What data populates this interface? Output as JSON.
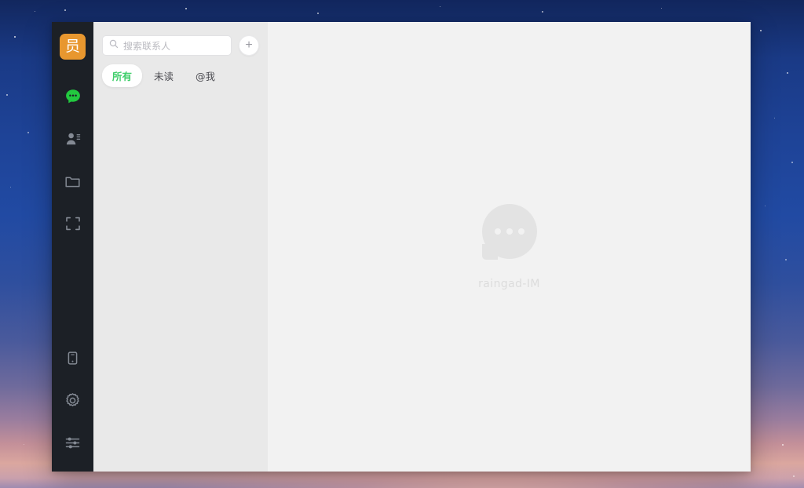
{
  "desktop": {
    "wallpaper_top_color": "#1e4397",
    "wallpaper_bottom_color": "#d8a39f"
  },
  "window": {
    "rail": {
      "avatar": {
        "label": "员",
        "bg_color": "#e8972f",
        "text_color": "#ffffff"
      },
      "items": [
        {
          "name": "chats",
          "icon": "chat-bubble-icon",
          "active": true,
          "color": "#22c93f"
        },
        {
          "name": "contacts",
          "icon": "contacts-icon",
          "active": false,
          "color": "#848a94"
        },
        {
          "name": "files",
          "icon": "folder-icon",
          "active": false,
          "color": "#848a94"
        },
        {
          "name": "scan",
          "icon": "scan-frame-icon",
          "active": false,
          "color": "#848a94"
        }
      ],
      "bottom_items": [
        {
          "name": "mobile",
          "icon": "mobile-device-icon",
          "color": "#848a94"
        },
        {
          "name": "settings",
          "icon": "gear-icon",
          "color": "#848a94"
        },
        {
          "name": "preferences",
          "icon": "sliders-icon",
          "color": "#848a94"
        }
      ]
    },
    "list_panel": {
      "search": {
        "placeholder": "搜索联系人",
        "value": "",
        "icon": "search-icon"
      },
      "add_button": {
        "label": "+",
        "icon": "plus-icon"
      },
      "tabs": [
        {
          "label": "所有",
          "active": true
        },
        {
          "label": "未读",
          "active": false
        },
        {
          "label": "@我",
          "active": false
        }
      ],
      "items": []
    },
    "main_panel": {
      "empty_state": {
        "icon": "chat-bubble-icon",
        "text": "raingad-IM"
      }
    }
  }
}
